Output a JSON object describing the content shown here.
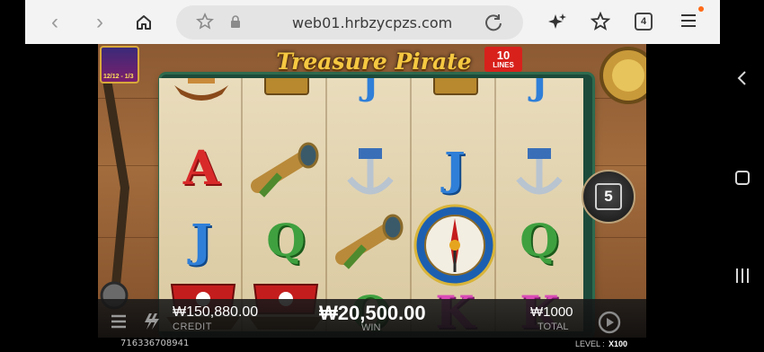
{
  "browser": {
    "url": "web01.hrbzycpzs.com",
    "tab_count": "4"
  },
  "game": {
    "title": "Treasure Pirate",
    "lines_number": "10",
    "lines_label": "LINES",
    "event_badge": "12/12 - 1/3",
    "level_button": "5",
    "reels": [
      [
        "ship",
        "letter-A",
        "letter-J",
        "pirate-ship"
      ],
      [
        "treasure-chest",
        "spyglass",
        "letter-Q",
        "pirate-ship"
      ],
      [
        "letter-J",
        "anchor",
        "spyglass",
        "letter-Q"
      ],
      [
        "treasure-chest",
        "letter-J",
        "compass",
        "letter-K"
      ],
      [
        "letter-J",
        "anchor",
        "letter-Q",
        "letter-K"
      ]
    ]
  },
  "bottom_bar": {
    "credit_value": "₩150,880.00",
    "credit_label": "CREDIT",
    "win_value": "₩20,500.00",
    "win_label": "WIN",
    "total_value": "₩1000",
    "total_label": "TOTAL",
    "serial": "716336708941",
    "level_label": "LEVEL :",
    "level_value": "X100"
  },
  "colors": {
    "letter_A": "#d92a2a",
    "letter_J": "#2f7fd8",
    "letter_Q": "#3fa03f",
    "letter_K": "#d94bb5",
    "accent_orange": "#ff6a18"
  }
}
